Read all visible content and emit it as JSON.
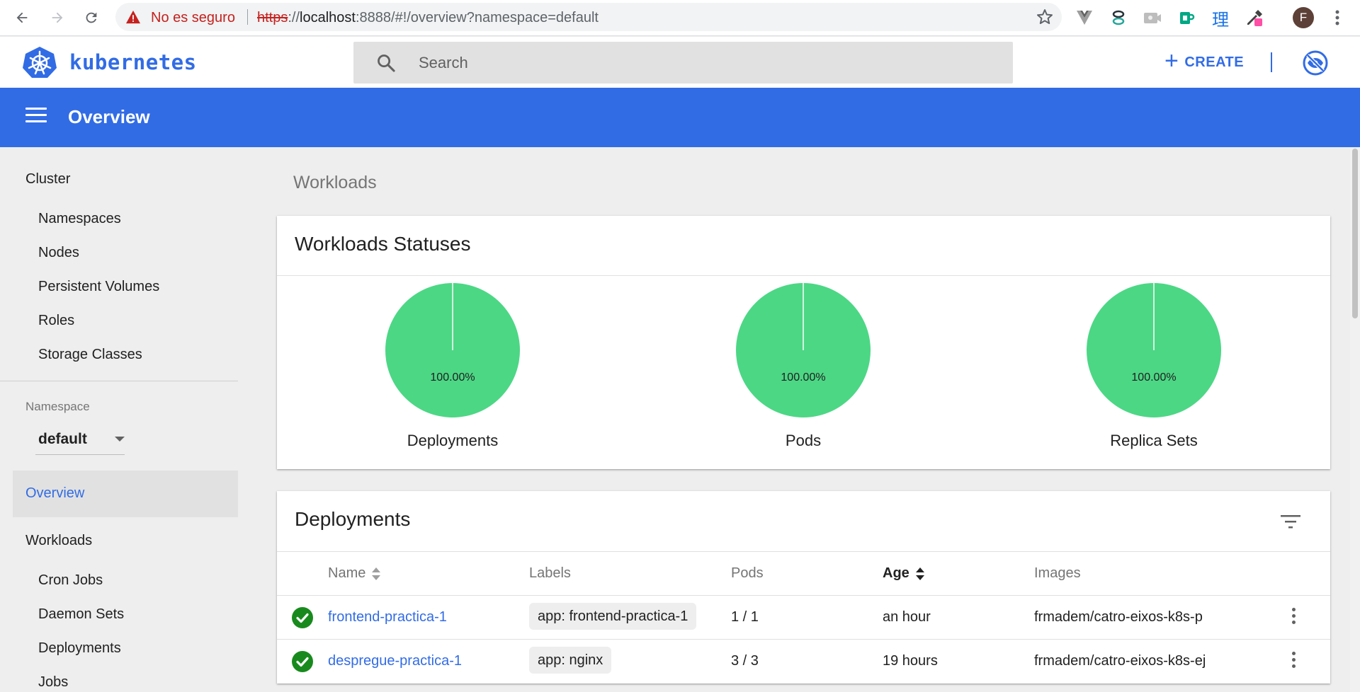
{
  "browser": {
    "insecure_label": "No es seguro",
    "url_scheme": "https",
    "url_sep": "://",
    "url_host": "localhost",
    "url_rest": ":8888/#!/overview?namespace=default",
    "avatar_initial": "F",
    "ext_kanji": "理"
  },
  "appbar": {
    "logo": "kubernetes",
    "search_placeholder": "Search",
    "create_label": "CREATE",
    "create_plus": "+"
  },
  "toolbar": {
    "title": "Overview"
  },
  "sidebar": {
    "cluster_heading": "Cluster",
    "cluster_items": [
      "Namespaces",
      "Nodes",
      "Persistent Volumes",
      "Roles",
      "Storage Classes"
    ],
    "namespace_label": "Namespace",
    "namespace_value": "default",
    "active_item": "Overview",
    "workloads_heading": "Workloads",
    "workload_items": [
      "Cron Jobs",
      "Daemon Sets",
      "Deployments",
      "Jobs"
    ]
  },
  "main": {
    "section_title": "Workloads",
    "statuses": {
      "title": "Workloads Statuses",
      "charts": [
        {
          "label": "Deployments",
          "percent": "100.00%",
          "value": 100
        },
        {
          "label": "Pods",
          "percent": "100.00%",
          "value": 100
        },
        {
          "label": "Replica Sets",
          "percent": "100.00%",
          "value": 100
        }
      ]
    },
    "deployments": {
      "title": "Deployments",
      "columns": [
        "Name",
        "Labels",
        "Pods",
        "Age",
        "Images"
      ],
      "rows": [
        {
          "name": "frontend-practica-1",
          "label": "app: frontend-practica-1",
          "pods": "1 / 1",
          "age": "an hour",
          "image": "frmadem/catro-eixos-k8s-p"
        },
        {
          "name": "despregue-practica-1",
          "label": "app: nginx",
          "pods": "3 / 3",
          "age": "19 hours",
          "image": "frmadem/catro-eixos-k8s-ej"
        }
      ]
    }
  },
  "colors": {
    "brand": "#326ce5",
    "success": "#4cd785",
    "ok_icon": "#188a1d",
    "insecure": "#c5221f"
  }
}
